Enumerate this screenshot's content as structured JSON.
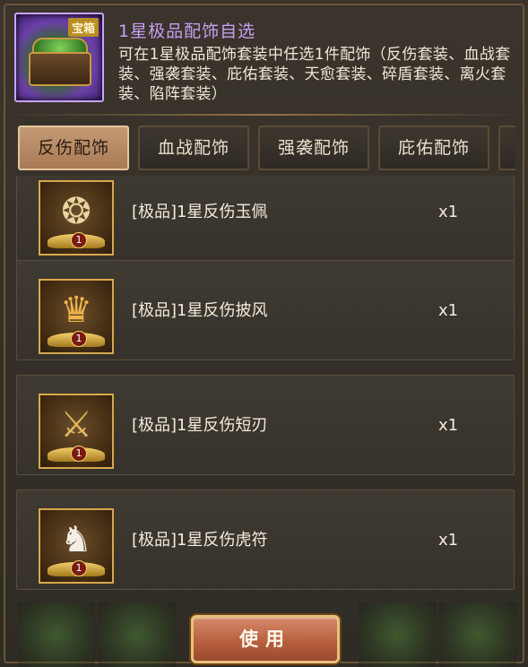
{
  "header": {
    "chest_tag": "宝箱",
    "title": "1星极品配饰自选",
    "description": "可在1星极品配饰套装中任选1件配饰（反伤套装、血战套装、强袭套装、庇佑套装、天愈套装、碎盾套装、离火套装、陷阵套装）"
  },
  "tabs": [
    {
      "label": "反伤配饰",
      "active": true
    },
    {
      "label": "血战配饰",
      "active": false
    },
    {
      "label": "强袭配饰",
      "active": false
    },
    {
      "label": "庇佑配饰",
      "active": false
    }
  ],
  "items": [
    {
      "name": "[极品]1星反伤玉佩",
      "qty": "x1",
      "star": "1",
      "icon": "jade-pendant-icon"
    },
    {
      "name": "[极品]1星反伤披风",
      "qty": "x1",
      "star": "1",
      "icon": "cape-icon"
    },
    {
      "name": "[极品]1星反伤短刃",
      "qty": "x1",
      "star": "1",
      "icon": "dagger-icon"
    },
    {
      "name": "[极品]1星反伤虎符",
      "qty": "x1",
      "star": "1",
      "icon": "tiger-tally-icon"
    }
  ],
  "use_button": {
    "label": "使用"
  },
  "background_tag": "宝箱",
  "colors": {
    "title": "#c69ff2",
    "active_tab": "#c49a75",
    "button": "#b8603f",
    "frame_gold": "#d8a84a"
  }
}
